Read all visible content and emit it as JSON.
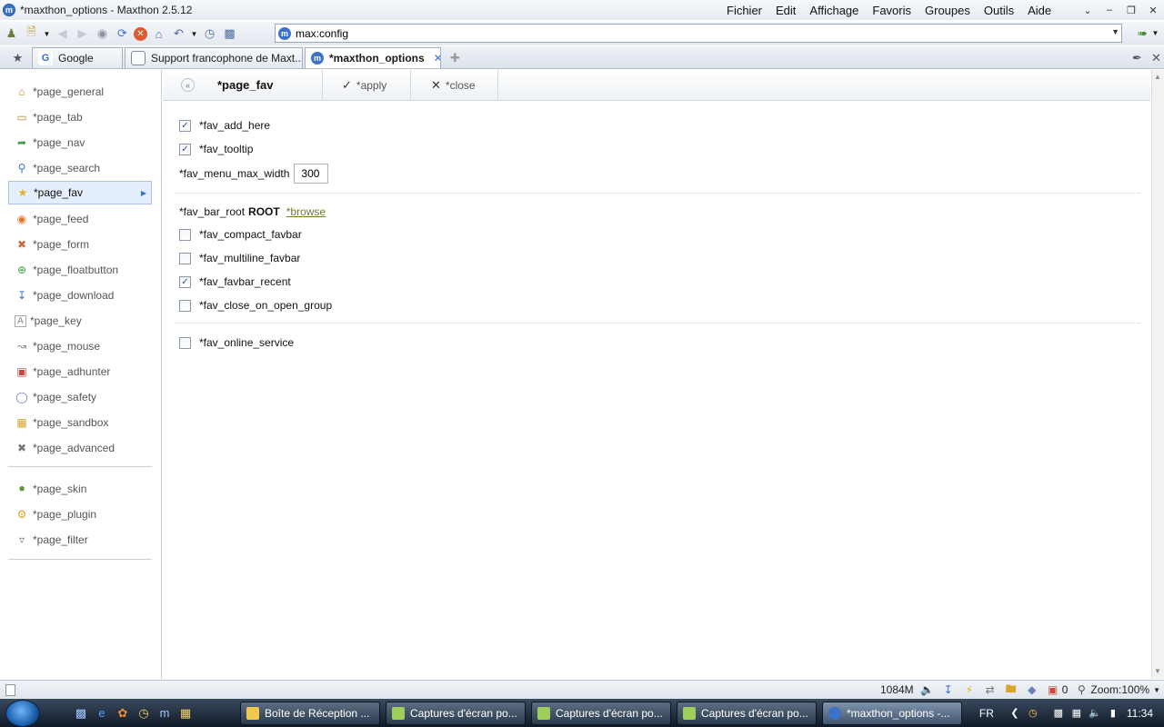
{
  "window": {
    "title": "*maxthon_options - Maxthon 2.5.12",
    "app_icon": "maxthon-icon"
  },
  "menu": [
    "Fichier",
    "Edit",
    "Affichage",
    "Favoris",
    "Groupes",
    "Outils",
    "Aide"
  ],
  "address": {
    "value": "max:config"
  },
  "tabs": [
    {
      "label": "Google",
      "icon": "google-icon",
      "active": false
    },
    {
      "label": "Support francophone de Maxt...",
      "icon": "forum-page-icon",
      "active": false
    },
    {
      "label": "*maxthon_options",
      "icon": "maxthon-icon",
      "active": true
    }
  ],
  "sidebar": {
    "items": [
      {
        "label": "*page_general",
        "icon": "home-icon"
      },
      {
        "label": "*page_tab",
        "icon": "tab-icon"
      },
      {
        "label": "*page_nav",
        "icon": "nav-icon"
      },
      {
        "label": "*page_search",
        "icon": "magnifier-icon"
      },
      {
        "label": "*page_fav",
        "icon": "star-icon",
        "selected": true
      },
      {
        "label": "*page_feed",
        "icon": "rss-icon"
      },
      {
        "label": "*page_form",
        "icon": "form-tools-icon"
      },
      {
        "label": "*page_floatbutton",
        "icon": "plus-circle-icon"
      },
      {
        "label": "*page_download",
        "icon": "download-icon"
      },
      {
        "label": "*page_key",
        "icon": "keyboard-icon"
      },
      {
        "label": "*page_mouse",
        "icon": "mouse-gesture-icon"
      },
      {
        "label": "*page_adhunter",
        "icon": "adhunter-icon"
      },
      {
        "label": "*page_safety",
        "icon": "shield-icon"
      },
      {
        "label": "*page_sandbox",
        "icon": "sandbox-box-icon"
      },
      {
        "label": "*page_advanced",
        "icon": "wrench-icon"
      }
    ],
    "items2": [
      {
        "label": "*page_skin",
        "icon": "skin-icon"
      },
      {
        "label": "*page_plugin",
        "icon": "plugin-gear-icon"
      },
      {
        "label": "*page_filter",
        "icon": "filter-icon"
      }
    ]
  },
  "content": {
    "heading": "*page_fav",
    "apply_label": "*apply",
    "close_label": "*close",
    "fav_add_here": {
      "label": "*fav_add_here",
      "checked": true
    },
    "fav_tooltip": {
      "label": "*fav_tooltip",
      "checked": true
    },
    "menu_max_width": {
      "label": "*fav_menu_max_width",
      "value": "300"
    },
    "bar_root": {
      "label": "*fav_bar_root",
      "value": "ROOT",
      "browse": "*browse"
    },
    "compact_favbar": {
      "label": "*fav_compact_favbar",
      "checked": false
    },
    "multiline_favbar": {
      "label": "*fav_multiline_favbar",
      "checked": false
    },
    "favbar_recent": {
      "label": "*fav_favbar_recent",
      "checked": true
    },
    "close_on_open_group": {
      "label": "*fav_close_on_open_group",
      "checked": false
    },
    "online_service": {
      "label": "*fav_online_service",
      "checked": false
    }
  },
  "statusbar": {
    "memory": "1084M",
    "popup_count": "0",
    "zoom": "Zoom:100%"
  },
  "taskbar": {
    "buttons": [
      {
        "label": "Boîte de Réception ...",
        "active": false
      },
      {
        "label": "Captures d'écran po...",
        "active": false
      },
      {
        "label": "Captures d'écran po...",
        "active": false
      },
      {
        "label": "Captures d'écran po...",
        "active": false
      },
      {
        "label": "*maxthon_options -...",
        "active": true
      }
    ],
    "language": "FR",
    "clock": "11:34"
  },
  "colors": {
    "accent": "#3a73c9",
    "link": "#6b7f1e",
    "selected_bg": "#e4eefc"
  }
}
